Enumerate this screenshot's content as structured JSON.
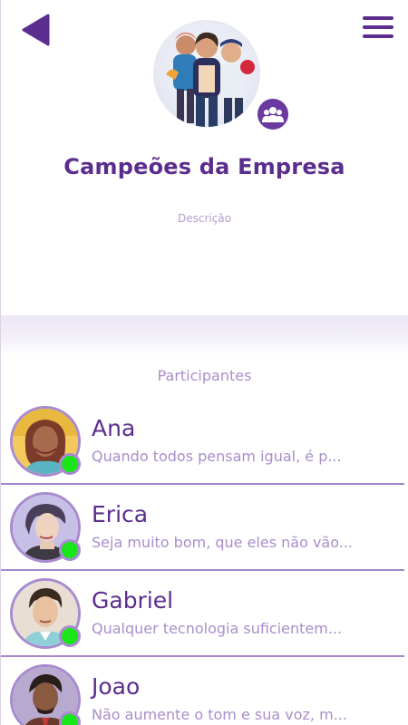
{
  "header": {
    "back_icon": "back-triangle-icon",
    "menu_icon": "hamburger-menu-icon"
  },
  "group": {
    "title": "Campeões da Empresa",
    "description_label": "Descrição",
    "badge_icon": "group-people-icon"
  },
  "participants": {
    "heading": "Participantes",
    "items": [
      {
        "name": "Ana",
        "status": "Quando todos pensam igual, é p...",
        "online": true
      },
      {
        "name": "Erica",
        "status": "Seja muito bom, que eles não vão...",
        "online": true
      },
      {
        "name": "Gabriel",
        "status": "Qualquer tecnologia suficientem...",
        "online": true
      },
      {
        "name": "Joao",
        "status": "Não aumente o tom e sua voz, m...",
        "online": true
      }
    ]
  },
  "colors": {
    "primary": "#5b2d8e",
    "secondary_text": "#a98ecb",
    "online": "#19e619",
    "avatar_border": "#a88bcf"
  }
}
